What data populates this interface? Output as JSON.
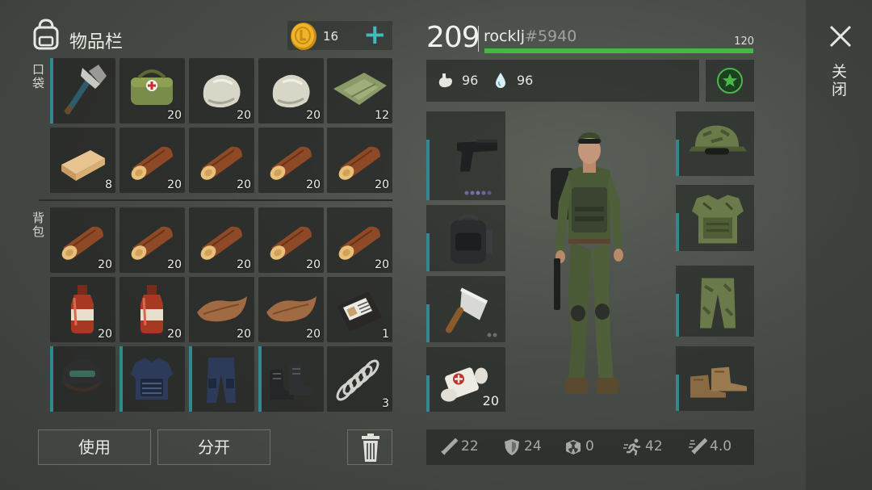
{
  "inventory": {
    "title": "物品栏",
    "coins": "16",
    "plus_label": "+",
    "pocket_label": "口袋",
    "backpack_label": "背包",
    "pocket_slots": [
      {
        "item": "axe-icon",
        "count": "",
        "accent": true
      },
      {
        "item": "medkit-bag-icon",
        "count": "20",
        "accent": false
      },
      {
        "item": "stone-icon",
        "count": "20",
        "accent": false
      },
      {
        "item": "stone-icon",
        "count": "20",
        "accent": false
      },
      {
        "item": "cloth-icon",
        "count": "12",
        "accent": false
      },
      {
        "item": "plank-icon",
        "count": "8",
        "accent": false
      },
      {
        "item": "log-icon",
        "count": "20",
        "accent": false
      },
      {
        "item": "log-icon",
        "count": "20",
        "accent": false
      },
      {
        "item": "log-icon",
        "count": "20",
        "accent": false
      },
      {
        "item": "log-icon",
        "count": "20",
        "accent": false
      }
    ],
    "backpack_slots": [
      {
        "item": "log-icon",
        "count": "20",
        "accent": false
      },
      {
        "item": "log-icon",
        "count": "20",
        "accent": false
      },
      {
        "item": "log-icon",
        "count": "20",
        "accent": false
      },
      {
        "item": "log-icon",
        "count": "20",
        "accent": false
      },
      {
        "item": "log-icon",
        "count": "20",
        "accent": false
      },
      {
        "item": "bottle-icon",
        "count": "20",
        "accent": false
      },
      {
        "item": "bottle-icon",
        "count": "20",
        "accent": false
      },
      {
        "item": "leather-icon",
        "count": "20",
        "accent": false
      },
      {
        "item": "leather-icon",
        "count": "20",
        "accent": false
      },
      {
        "item": "wallet-icon",
        "count": "1",
        "accent": false
      },
      {
        "item": "helmet-icon",
        "count": "",
        "accent": true
      },
      {
        "item": "armor-vest-icon",
        "count": "",
        "accent": true
      },
      {
        "item": "armor-pants-icon",
        "count": "",
        "accent": true
      },
      {
        "item": "boots-icon",
        "count": "",
        "accent": true
      },
      {
        "item": "spring-icon",
        "count": "3",
        "accent": false
      }
    ],
    "use_button": "使用",
    "split_button": "分开"
  },
  "player": {
    "level": "209",
    "name": "rocklj",
    "tag": "#5940",
    "xp_max": "120",
    "xp_fraction": 1.0,
    "food": "96",
    "water": "96"
  },
  "equipment": {
    "left": [
      {
        "item": "pistol-icon",
        "count": ""
      },
      {
        "item": "backpack-icon",
        "count": ""
      },
      {
        "item": "cleaver-icon",
        "count": ""
      },
      {
        "item": "bandage-icon",
        "count": "20"
      }
    ],
    "right": [
      {
        "item": "camo-cap-icon",
        "count": ""
      },
      {
        "item": "camo-vest-icon",
        "count": ""
      },
      {
        "item": "camo-pants-icon",
        "count": ""
      },
      {
        "item": "shoes-icon",
        "count": ""
      }
    ]
  },
  "stats": {
    "attack": "22",
    "defense": "24",
    "radiation": "0",
    "speed": "42",
    "attack_speed": "4.0"
  },
  "close_label": "关闭",
  "colors": {
    "accent": "#2f8a8e",
    "xp": "#4ab64a",
    "plus": "#3fbcc0",
    "coin": "#e2a41c"
  }
}
